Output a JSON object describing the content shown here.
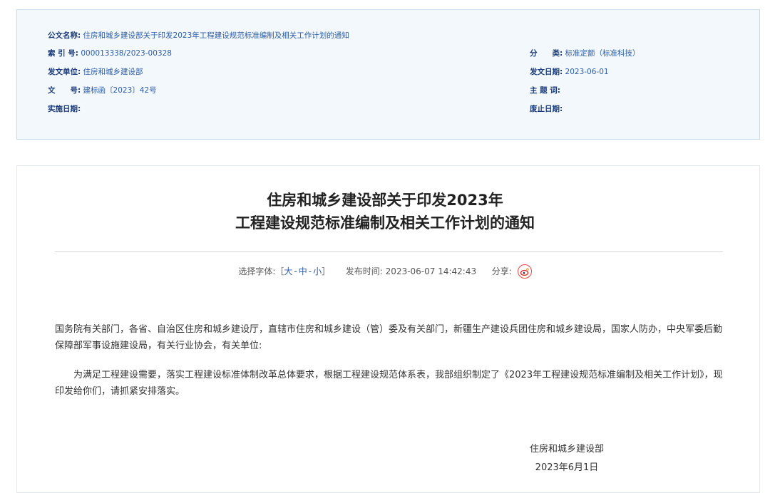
{
  "meta": {
    "title_label": "公文名称:",
    "title_value": "住房和城乡建设部关于印发2023年工程建设规范标准编制及相关工作计划的通知",
    "index_label": "索 引 号:",
    "index_value": "000013338/2023-00328",
    "category_label": "分　　类:",
    "category_value": "标准定额（标准科技）",
    "issuer_label": "发文单位:",
    "issuer_value": "住房和城乡建设部",
    "date_label": "发文日期:",
    "date_value": "2023-06-01",
    "docno_label": "文　　号:",
    "docno_value": "建标函〔2023〕42号",
    "keywords_label": "主 题 词:",
    "keywords_value": "",
    "effective_label": "实施日期:",
    "effective_value": "",
    "expire_label": "废止日期:",
    "expire_value": ""
  },
  "document": {
    "title_line1": "住房和城乡建设部关于印发2023年",
    "title_line2": "工程建设规范标准编制及相关工作计划的通知",
    "font_select_label": "选择字体:［",
    "font_large": "大",
    "font_medium": "中",
    "font_small": "小",
    "font_close": "］",
    "font_sep": "-",
    "publish_label": "发布时间:",
    "publish_time": "2023-06-07 14:42:43",
    "share_label": "分享:",
    "recipients": "国务院有关部门，各省、自治区住房和城乡建设厅，直辖市住房和城乡建设（管）委及有关部门，新疆生产建设兵团住房和城乡建设局，国家人防办，中央军委后勤保障部军事设施建设局，有关行业协会，有关单位:",
    "body": "为满足工程建设需要，落实工程建设标准体制改革总体要求，根据工程建设规范体系表，我部组织制定了《2023年工程建设规范标准编制及相关工作计划》，现印发给你们，请抓紧安排落实。",
    "signature_org": "住房和城乡建设部",
    "signature_date": "2023年6月1日"
  },
  "colors": {
    "meta_bg": "#f3f8fd",
    "label": "#1a3a78",
    "link": "#2a5ca8",
    "weibo": "#e44"
  }
}
